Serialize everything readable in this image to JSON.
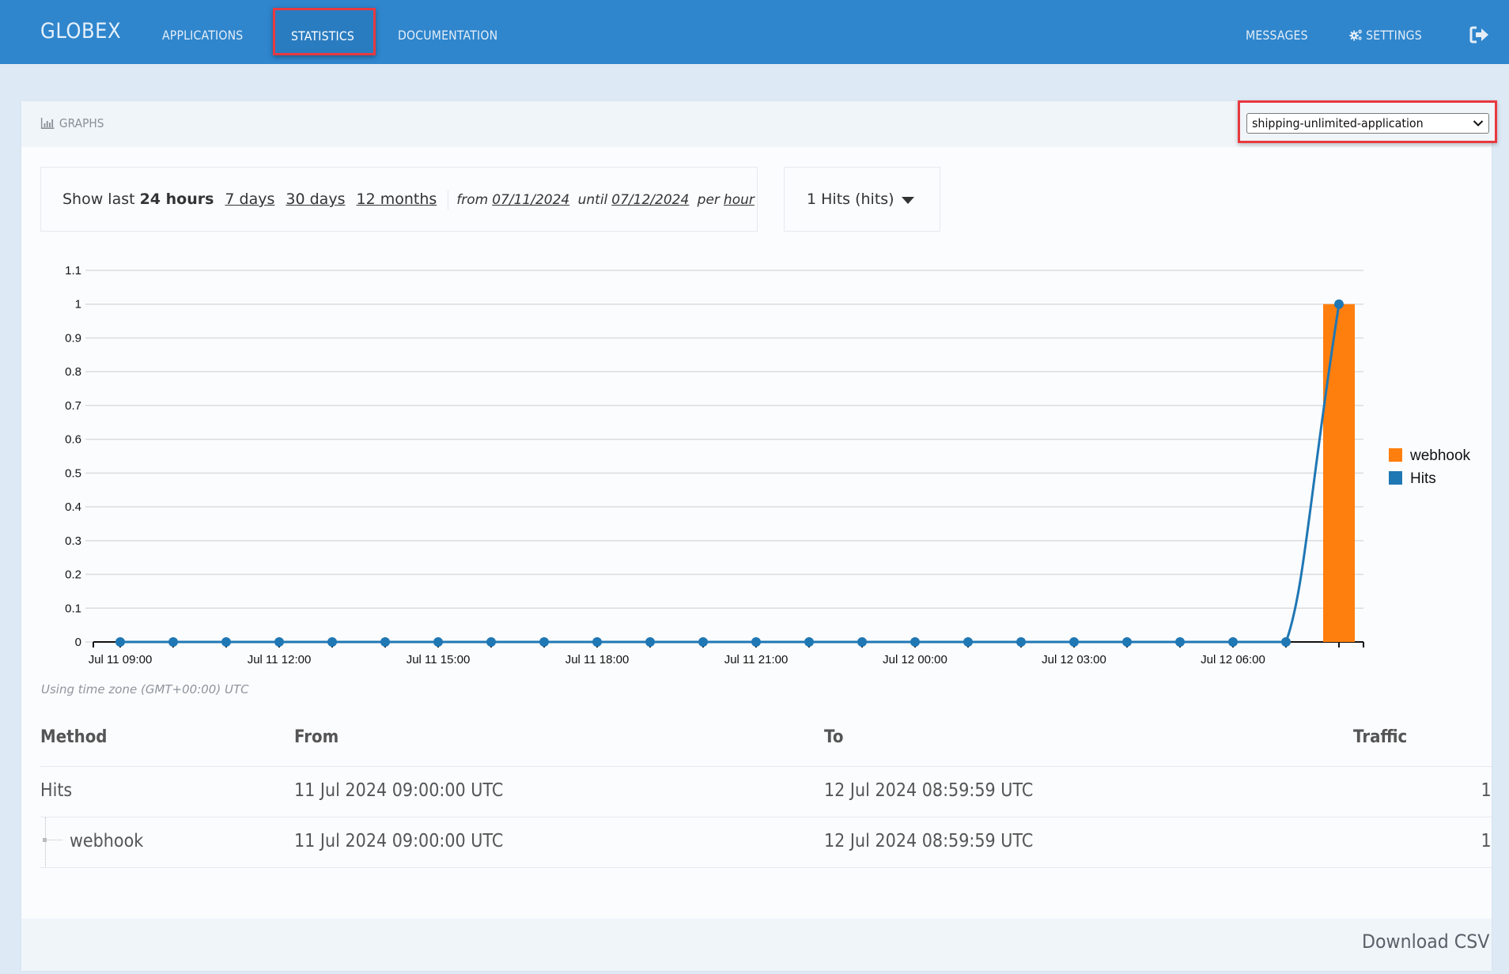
{
  "header": {
    "brand": "GLOBEX",
    "nav": [
      {
        "label": "APPLICATIONS",
        "active": false
      },
      {
        "label": "STATISTICS",
        "active": true
      },
      {
        "label": "DOCUMENTATION",
        "active": false
      }
    ],
    "right_nav": {
      "messages": "MESSAGES",
      "settings": "SETTINGS",
      "settings_icon": "cogs-icon",
      "signout_icon": "sign-out-icon"
    },
    "colors": {
      "bar": "#2f86cd",
      "highlight": "#e8393f"
    }
  },
  "panel": {
    "title": "GRAPHS",
    "title_icon": "bar-chart-icon",
    "application_select": {
      "value": "shipping-unlimited-application"
    }
  },
  "filters": {
    "show_last_label": "Show last",
    "active_period": "24 hours",
    "periods": [
      "7 days",
      "30 days",
      "12 months"
    ],
    "from_label": "from",
    "from_date": "07/11/2024",
    "until_label": "until",
    "until_date": "07/12/2024",
    "per_label": "per",
    "granularity": "hour",
    "metric_dropdown": "1 Hits (hits)"
  },
  "chart_data": {
    "type": "bar+line",
    "title": "",
    "xlabel": "",
    "ylabel": "",
    "ylim": [
      0,
      1.1
    ],
    "yticks": [
      0,
      0.1,
      0.2,
      0.3,
      0.4,
      0.5,
      0.6,
      0.7,
      0.8,
      0.9,
      1,
      1.1
    ],
    "grid": true,
    "legend_position": "right",
    "x": [
      "Jul 11 09:00",
      "Jul 11 10:00",
      "Jul 11 11:00",
      "Jul 11 12:00",
      "Jul 11 13:00",
      "Jul 11 14:00",
      "Jul 11 15:00",
      "Jul 11 16:00",
      "Jul 11 17:00",
      "Jul 11 18:00",
      "Jul 11 19:00",
      "Jul 11 20:00",
      "Jul 11 21:00",
      "Jul 11 22:00",
      "Jul 11 23:00",
      "Jul 12 00:00",
      "Jul 12 01:00",
      "Jul 12 02:00",
      "Jul 12 03:00",
      "Jul 12 04:00",
      "Jul 12 05:00",
      "Jul 12 06:00",
      "Jul 12 07:00",
      "Jul 12 08:00"
    ],
    "xtick_labels": [
      "Jul 11 09:00",
      "Jul 11 12:00",
      "Jul 11 15:00",
      "Jul 11 18:00",
      "Jul 11 21:00",
      "Jul 12 00:00",
      "Jul 12 03:00",
      "Jul 12 06:00"
    ],
    "series": [
      {
        "name": "webhook",
        "type": "bar",
        "color": "#ff7f0e",
        "values": [
          0,
          0,
          0,
          0,
          0,
          0,
          0,
          0,
          0,
          0,
          0,
          0,
          0,
          0,
          0,
          0,
          0,
          0,
          0,
          0,
          0,
          0,
          0,
          1
        ]
      },
      {
        "name": "Hits",
        "type": "line",
        "color": "#1f77b4",
        "values": [
          0,
          0,
          0,
          0,
          0,
          0,
          0,
          0,
          0,
          0,
          0,
          0,
          0,
          0,
          0,
          0,
          0,
          0,
          0,
          0,
          0,
          0,
          0,
          1
        ]
      }
    ]
  },
  "timezone_note": "Using time zone (GMT+00:00) UTC",
  "table": {
    "columns": [
      "Method",
      "From",
      "To",
      "Traffic"
    ],
    "rows": [
      {
        "method": "Hits",
        "from": "11 Jul 2024 09:00:00 UTC",
        "to": "12 Jul 2024 08:59:59 UTC",
        "traffic": "1",
        "child": false
      },
      {
        "method": "webhook",
        "from": "11 Jul 2024 09:00:00 UTC",
        "to": "12 Jul 2024 08:59:59 UTC",
        "traffic": "1",
        "child": true
      }
    ]
  },
  "footer": {
    "download_label": "Download CSV"
  }
}
